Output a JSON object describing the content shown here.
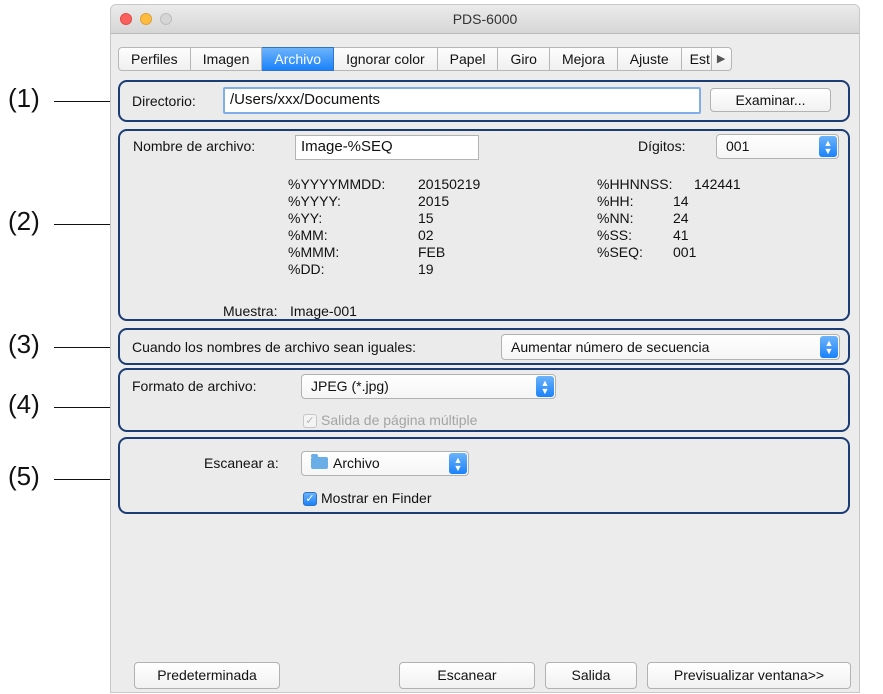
{
  "window": {
    "title": "PDS-6000"
  },
  "tabs": [
    {
      "label": "Perfiles"
    },
    {
      "label": "Imagen"
    },
    {
      "label": "Archivo"
    },
    {
      "label": "Ignorar color"
    },
    {
      "label": "Papel"
    },
    {
      "label": "Giro"
    },
    {
      "label": "Mejora"
    },
    {
      "label": "Ajuste"
    },
    {
      "label": "Est"
    }
  ],
  "tab_scroll_icon": "▶",
  "callouts": [
    "(1)",
    "(2)",
    "(3)",
    "(4)",
    "(5)"
  ],
  "directory": {
    "label": "Directorio:",
    "value": "/Users/xxx/Documents",
    "browse_button": "Examinar..."
  },
  "filename": {
    "label": "Nombre de archivo:",
    "value": "Image-%SEQ",
    "digits_label": "Dígitos:",
    "digits_value": "001",
    "tokens_left": [
      {
        "key": "%YYYYMMDD:",
        "value": "20150219"
      },
      {
        "key": "%YYYY:",
        "value": "2015"
      },
      {
        "key": "%YY:",
        "value": "15"
      },
      {
        "key": "%MM:",
        "value": "02"
      },
      {
        "key": "%MMM:",
        "value": "FEB"
      },
      {
        "key": "%DD:",
        "value": "19"
      }
    ],
    "tokens_right": [
      {
        "key": "%HHNNSS:",
        "value": "142441"
      },
      {
        "key": "%HH:",
        "value": "14"
      },
      {
        "key": "%NN:",
        "value": "24"
      },
      {
        "key": "%SS:",
        "value": "41"
      },
      {
        "key": "%SEQ:",
        "value": "001"
      }
    ],
    "sample_label": "Muestra:",
    "sample_value": "Image-001"
  },
  "duplicate": {
    "label": "Cuando los nombres de archivo sean iguales:",
    "value": "Aumentar número de secuencia"
  },
  "format": {
    "label": "Formato de archivo:",
    "value": "JPEG (*.jpg)",
    "multipage_label": "Salida de página múltiple",
    "multipage_checked": true,
    "multipage_enabled": false
  },
  "scan_to": {
    "label": "Escanear a:",
    "value": "Archivo",
    "show_finder_label": "Mostrar en Finder",
    "show_finder_checked": true
  },
  "footer": {
    "default_button": "Predeterminada",
    "scan_button": "Escanear",
    "exit_button": "Salida",
    "preview_button": "Previsualizar ventana>>"
  },
  "colors": {
    "accent": "#1a82fb",
    "callout_border": "#1b3d73"
  }
}
